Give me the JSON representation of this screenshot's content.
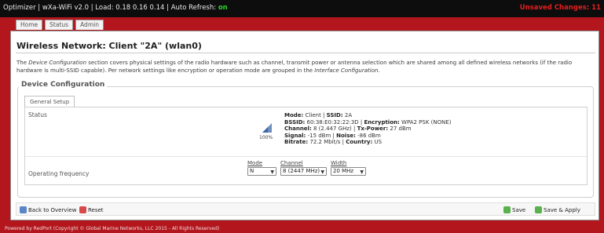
{
  "header": {
    "app_title": "Optimizer | wXa-WiFi v2.0 | Load: 0.18 0.16 0.14 | Auto Refresh: ",
    "auto_refresh_state": "on",
    "unsaved_changes": "Unsaved Changes: 11"
  },
  "tabs": [
    "Home",
    "Status",
    "Admin"
  ],
  "page": {
    "title": "Wireless Network: Client \"2A\" (wlan0)",
    "description": {
      "part1": "The ",
      "link1": "Device Configuration",
      "part2": " section covers physical settings of the radio hardware such as channel, transmit power or antenna selection which are shared among all defined wireless networks (if the radio hardware is multi-SSID capable). Per network settings like encryption or operation mode are grouped in the ",
      "link2": "Interface Configuration",
      "part3": "."
    }
  },
  "device_config": {
    "legend": "Device Configuration",
    "subtab": "General Setup",
    "status_label": "Status",
    "signal_percent": "100%",
    "status": {
      "mode_label": "Mode:",
      "mode_value": " Client | ",
      "ssid_label": "SSID:",
      "ssid_value": " 2A",
      "bssid_label": "BSSID:",
      "bssid_value": " 60:38:E0:32:22:3D | ",
      "enc_label": "Encryption:",
      "enc_value": " WPA2 PSK (NONE)",
      "channel_label": "Channel:",
      "channel_value": " 8 (2.447 GHz) | ",
      "txpower_label": "Tx-Power:",
      "txpower_value": " 27 dBm",
      "signal_label": "Signal:",
      "signal_value": " -15 dBm | ",
      "noise_label": "Noise:",
      "noise_value": " -86 dBm",
      "bitrate_label": "Bitrate:",
      "bitrate_value": " 72.2 Mbit/s | ",
      "country_label": "Country:",
      "country_value": " US"
    },
    "operating_frequency_label": "Operating frequency",
    "mode_label": "Mode",
    "mode_value": "N",
    "channel_label": "Channel",
    "channel_value": "8 (2447 MHz)",
    "width_label": "Width",
    "width_value": "20 MHz"
  },
  "footer": {
    "back_label": "Back to Overview",
    "reset_label": "Reset",
    "save_label": "Save",
    "save_apply_label": "Save & Apply"
  },
  "copyright": "Powered by RedPort (Copyright © Global Marine Networks, LLC 2015 - All Rights Reserved)",
  "colors": {
    "background": "#b3161c",
    "topbar": "#0d0d0d",
    "auto_refresh_on": "#2fd12f",
    "unsaved": "#e02020"
  },
  "icons": [
    "signal-strength-icon",
    "back-arrow-icon",
    "reset-icon",
    "save-icon",
    "save-apply-icon",
    "chevron-down-icon"
  ]
}
